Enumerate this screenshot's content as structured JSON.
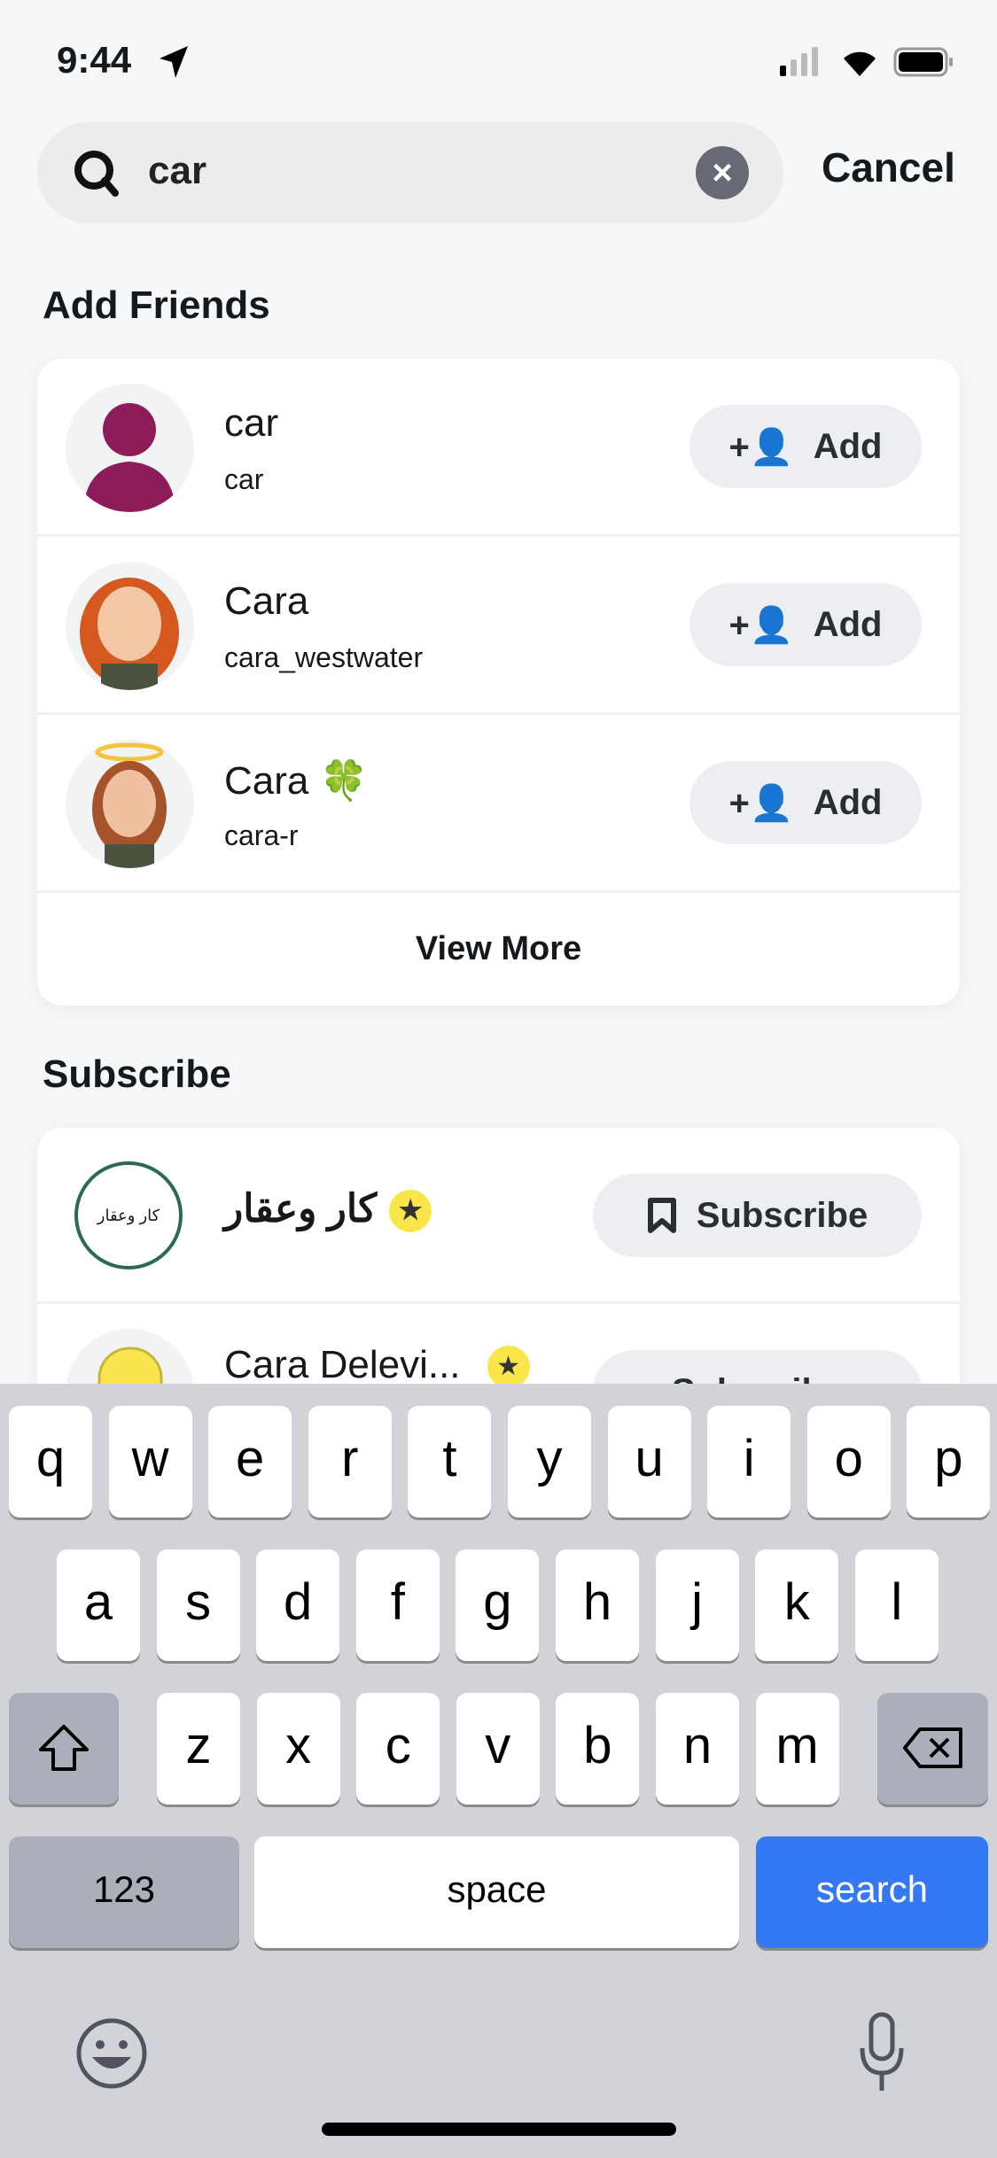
{
  "status_bar": {
    "time": "9:44"
  },
  "search": {
    "value": "car",
    "cancel_label": "Cancel"
  },
  "add_friends": {
    "title": "Add Friends",
    "items": [
      {
        "name": "car",
        "username": "car",
        "button": "Add",
        "avatar_color": "#8e1b5a"
      },
      {
        "name": "Cara",
        "username": "cara_westwater",
        "button": "Add"
      },
      {
        "name": "Cara 🍀",
        "username": "cara-r",
        "button": "Add"
      }
    ],
    "view_more": "View More"
  },
  "subscribe": {
    "title": "Subscribe",
    "items": [
      {
        "name": "كار وعقار",
        "logo_text": "كار وعقار",
        "button": "Subscribe",
        "verified": true
      },
      {
        "name": "Cara Delevi...",
        "button": "Subscribe",
        "verified": true
      }
    ]
  },
  "keyboard": {
    "row1": [
      "q",
      "w",
      "e",
      "r",
      "t",
      "y",
      "u",
      "i",
      "o",
      "p"
    ],
    "row2": [
      "a",
      "s",
      "d",
      "f",
      "g",
      "h",
      "j",
      "k",
      "l"
    ],
    "row3": [
      "z",
      "x",
      "c",
      "v",
      "b",
      "n",
      "m"
    ],
    "numbers": "123",
    "space": "space",
    "search": "search",
    "search_color": "#3478f6"
  }
}
